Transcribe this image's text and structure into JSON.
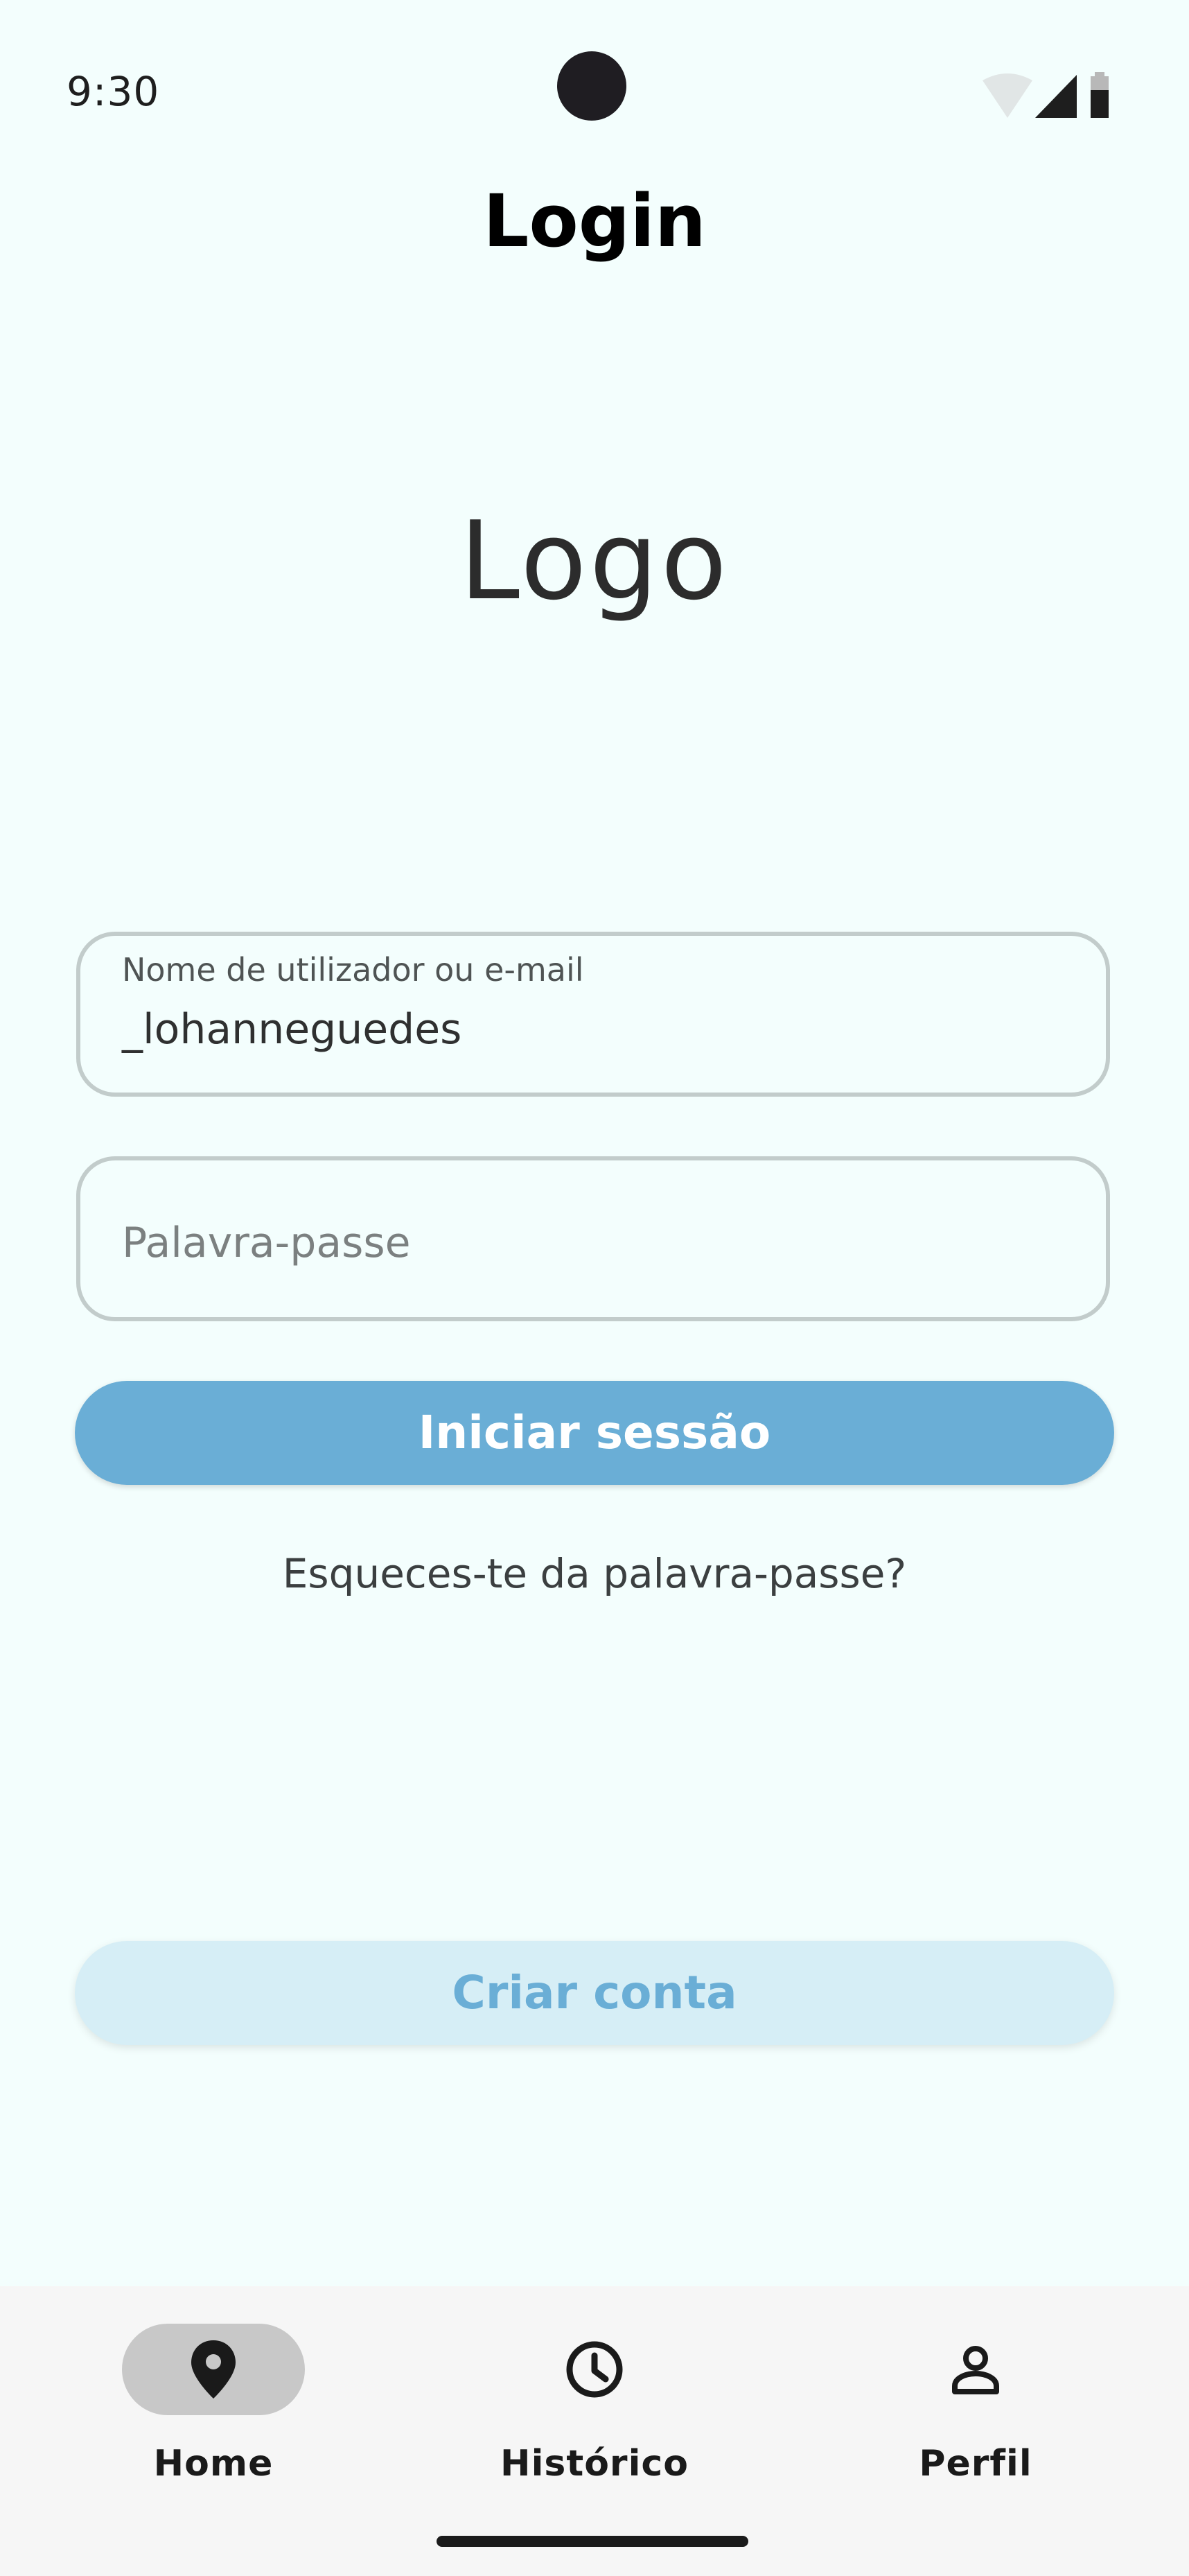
{
  "status_bar": {
    "time": "9:30",
    "icons": [
      "wifi-icon",
      "signal-icon",
      "battery-icon"
    ]
  },
  "app_bar": {
    "title": "Login"
  },
  "logo": {
    "text": "Logo"
  },
  "form": {
    "username": {
      "label": "Nome de utilizador ou  e-mail",
      "value": "_lohanneguedes"
    },
    "password": {
      "placeholder": "Palavra-passe"
    },
    "login_button": "Iniciar sessão",
    "forgot_link": "Esqueces-te da palavra-passe?",
    "create_account_button": "Criar conta"
  },
  "bottom_nav": {
    "items": [
      {
        "label": "Home",
        "icon": "location-pin-icon",
        "active": true
      },
      {
        "label": "Histórico",
        "icon": "clock-icon",
        "active": false
      },
      {
        "label": "Perfil",
        "icon": "person-icon",
        "active": false
      }
    ]
  },
  "colors": {
    "background": "#f3fefd",
    "primary": "#6aaed6",
    "secondary_bg": "#d6eef6",
    "nav_active_pill": "#c8c8c8"
  }
}
